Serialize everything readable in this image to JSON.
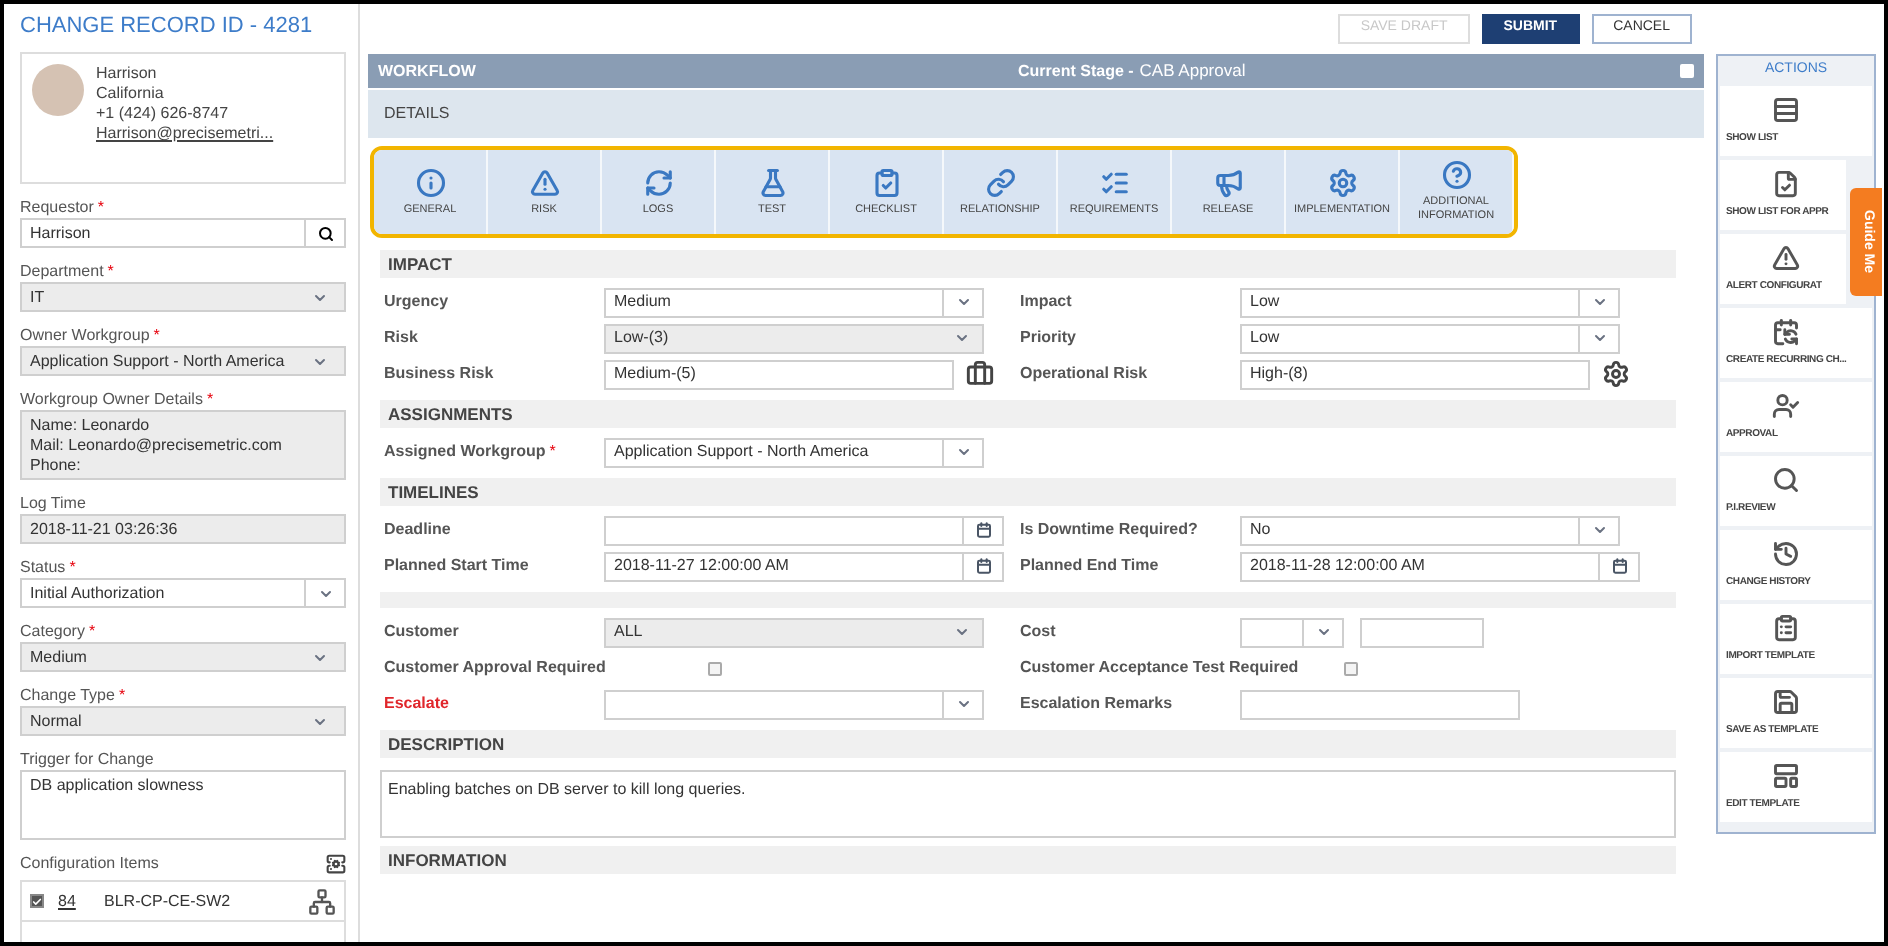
{
  "header": {
    "title": "CHANGE RECORD ID - 4281",
    "buttons": [
      {
        "label": "SAVE DRAFT",
        "kind": "draft"
      },
      {
        "label": "SUBMIT",
        "kind": "primary"
      },
      {
        "label": "CANCEL",
        "kind": "secondary"
      }
    ]
  },
  "contact": {
    "name": "Harrison",
    "location": "California",
    "phone": "+1 (424) 626-8747",
    "email": "Harrison@precisemetri..."
  },
  "left_fields": [
    {
      "label": "Requestor",
      "required_mark": "*",
      "kind": "search",
      "value": "Harrison",
      "disabled": false
    },
    {
      "label": "Department",
      "required_mark": "*",
      "kind": "select",
      "value": "IT",
      "disabled": true
    },
    {
      "label": "Owner Workgroup",
      "required_mark": "*",
      "kind": "select",
      "value": "Application Support - North America",
      "disabled": true
    },
    {
      "label": "Workgroup Owner Details",
      "required_mark": "*",
      "kind": "textarea",
      "lines": [
        "Name: Leonardo",
        "Mail: Leonardo@precisemetric.com",
        "Phone:"
      ],
      "disabled": true
    },
    {
      "label": "Log Time",
      "kind": "text",
      "value": "2018-11-21 03:26:36",
      "disabled": true
    },
    {
      "label": "Status",
      "required_mark": "*",
      "kind": "select",
      "value": "Initial Authorization",
      "disabled": false
    },
    {
      "label": "Category",
      "required_mark": "*",
      "kind": "select",
      "value": "Medium",
      "disabled": true
    },
    {
      "label": "Change Type",
      "required_mark": "*",
      "kind": "select",
      "value": "Normal",
      "disabled": true
    },
    {
      "label": "Trigger for Change",
      "kind": "textarea",
      "lines": [
        "DB application slowness"
      ],
      "disabled": false
    }
  ],
  "configuration_items": {
    "label": "Configuration Items",
    "rows": [
      {
        "checked": true,
        "id": "84",
        "name": "BLR-CP-CE-SW2"
      }
    ]
  },
  "workflow": {
    "title": "WORKFLOW",
    "stage_label": "Current Stage -",
    "stage": "CAB Approval"
  },
  "details": {
    "title": "DETAILS",
    "tabs": [
      {
        "label": "GENERAL",
        "kind": "info"
      },
      {
        "label": "RISK",
        "kind": "risk"
      },
      {
        "label": "LOGS",
        "kind": "logs"
      },
      {
        "label": "TEST",
        "kind": "test"
      },
      {
        "label": "CHECKLIST",
        "kind": "checklist"
      },
      {
        "label": "RELATIONSHIP",
        "kind": "relationship"
      },
      {
        "label": "REQUIREMENTS",
        "kind": "requirements"
      },
      {
        "label": "RELEASE",
        "kind": "release"
      },
      {
        "label": "IMPLEMENTATION",
        "kind": "implementation"
      },
      {
        "label": "ADDITIONAL INFORMATION",
        "kind": "help"
      }
    ]
  },
  "sections": [
    {
      "title": "IMPACT",
      "fields": [
        {
          "label": "Urgency",
          "alert": false,
          "kind": "select",
          "value": "Medium",
          "disabled": false
        },
        {
          "label": "Impact",
          "alert": false,
          "kind": "select",
          "value": "Low",
          "disabled": false
        },
        {
          "label": "Risk",
          "alert": false,
          "kind": "select",
          "value": "Low-(3)",
          "disabled": true
        },
        {
          "label": "Priority",
          "alert": false,
          "kind": "select",
          "value": "Low",
          "disabled": false
        },
        {
          "label": "Business Risk",
          "alert": false,
          "kind": "scored",
          "value": "Medium-(5)"
        },
        {
          "label": "Operational Risk",
          "alert": false,
          "kind": "scored",
          "value": "High-(8)"
        }
      ]
    },
    {
      "title": "ASSIGNMENTS",
      "fields": [
        {
          "label": "Assigned Workgroup",
          "required_mark": "*",
          "alert": false,
          "kind": "select",
          "value": "Application Support - North America",
          "disabled": false
        }
      ]
    },
    {
      "title": "TIMELINES",
      "fields": [
        {
          "label": "Deadline",
          "alert": false,
          "kind": "date"
        },
        {
          "label": "Is Downtime Required?",
          "alert": false,
          "kind": "select",
          "value": "No",
          "disabled": false
        },
        {
          "label": "Planned Start Time",
          "alert": false,
          "kind": "date",
          "value": "2018-11-27 12:00:00 AM"
        },
        {
          "label": "Planned End Time",
          "alert": false,
          "kind": "date",
          "value": "2018-11-28 12:00:00 AM"
        }
      ]
    },
    {
      "fields": [
        {
          "label": "Customer",
          "alert": false,
          "kind": "select",
          "value": "ALL",
          "disabled": true
        },
        {
          "label": "Cost",
          "alert": false,
          "kind": "cost"
        },
        {
          "label": "Customer Approval Required",
          "alert": false,
          "kind": "checkbox",
          "checked": false
        },
        {
          "label": "Customer Acceptance Test Required",
          "alert": false,
          "kind": "checkbox",
          "checked": false
        },
        {
          "label": "Escalate",
          "alert": true,
          "kind": "select",
          "disabled": false
        },
        {
          "label": "Escalation Remarks",
          "alert": false,
          "kind": "text"
        }
      ]
    },
    {
      "title": "DESCRIPTION",
      "text": "Enabling batches on DB server to kill long queries."
    },
    {
      "title": "INFORMATION"
    }
  ],
  "actions": {
    "title": "ACTIONS",
    "items": [
      {
        "label": "SHOW LIST",
        "kind": "list"
      },
      {
        "label": "SHOW LIST FOR APPR",
        "kind": "approve-list"
      },
      {
        "label": "ALERT CONFIGURAT",
        "kind": "alert"
      },
      {
        "label": "CREATE RECURRING CH...",
        "kind": "recurring"
      },
      {
        "label": "APPROVAL",
        "kind": "approval"
      },
      {
        "label": "P.I.REVIEW",
        "kind": "review"
      },
      {
        "label": "CHANGE HISTORY",
        "kind": "history"
      },
      {
        "label": "IMPORT TEMPLATE",
        "kind": "import"
      },
      {
        "label": "SAVE AS TEMPLATE",
        "kind": "save"
      },
      {
        "label": "EDIT TEMPLATE",
        "kind": "edit"
      }
    ],
    "guide": "Guide Me"
  }
}
